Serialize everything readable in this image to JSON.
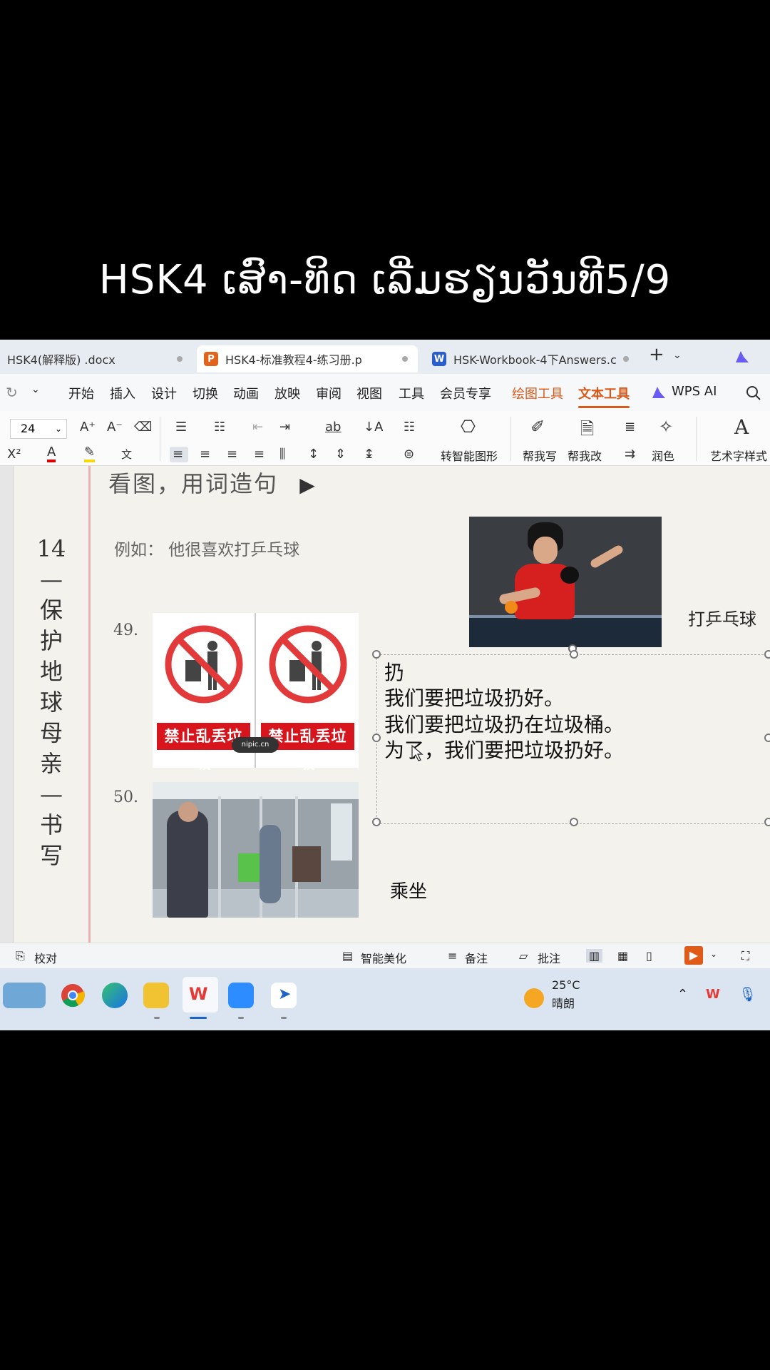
{
  "caption": "HSK4 ເສົາ-ທິດ ເລີ່ມຮຽນວັນທີ5/9",
  "tabs": [
    {
      "label": "HSK4(解释版) .docx",
      "icon": "doc-icon"
    },
    {
      "label": "HSK4-标准教程4-练习册.p",
      "icon": "ppt-icon",
      "icon_text": "P",
      "color": "#e0621b"
    },
    {
      "label": "HSK-Workbook-4下Answers.c",
      "icon": "word-icon",
      "icon_text": "W",
      "color": "#2a5ccf"
    }
  ],
  "menu": [
    "开始",
    "插入",
    "设计",
    "切换",
    "动画",
    "放映",
    "审阅",
    "视图",
    "工具",
    "会员专享",
    "绘图工具",
    "文本工具",
    "WPS AI"
  ],
  "ribbon": {
    "font_size": "24",
    "smart_shape": "转智能图形",
    "help_write": "帮我写",
    "help_edit": "帮我改",
    "polish": "润色",
    "art_style": "艺术字样式"
  },
  "doc": {
    "heading": "看图，用词造句",
    "lesson_chars": [
      "14",
      "—",
      "保",
      "护",
      "地",
      "球",
      "母",
      "亲",
      "—",
      "书",
      "写"
    ],
    "example": "例如：  他很喜欢打乒乓球",
    "pong_label": "打乒乓球",
    "q49": "49.",
    "q50": "50.",
    "sign_text": "禁止乱丢垃圾",
    "watermark": "nipic.cn",
    "subway_label": "乘坐",
    "textbox_lines": [
      "扔",
      "我们要把垃圾扔好。",
      "我们要把垃圾扔在垃圾桶。",
      "为了，我们要把垃圾扔好。"
    ]
  },
  "status": {
    "proofread": "校对",
    "beautify": "智能美化",
    "notes": "备注",
    "comment": "批注"
  },
  "weather": {
    "temp": "25°C",
    "desc": "晴朗"
  }
}
